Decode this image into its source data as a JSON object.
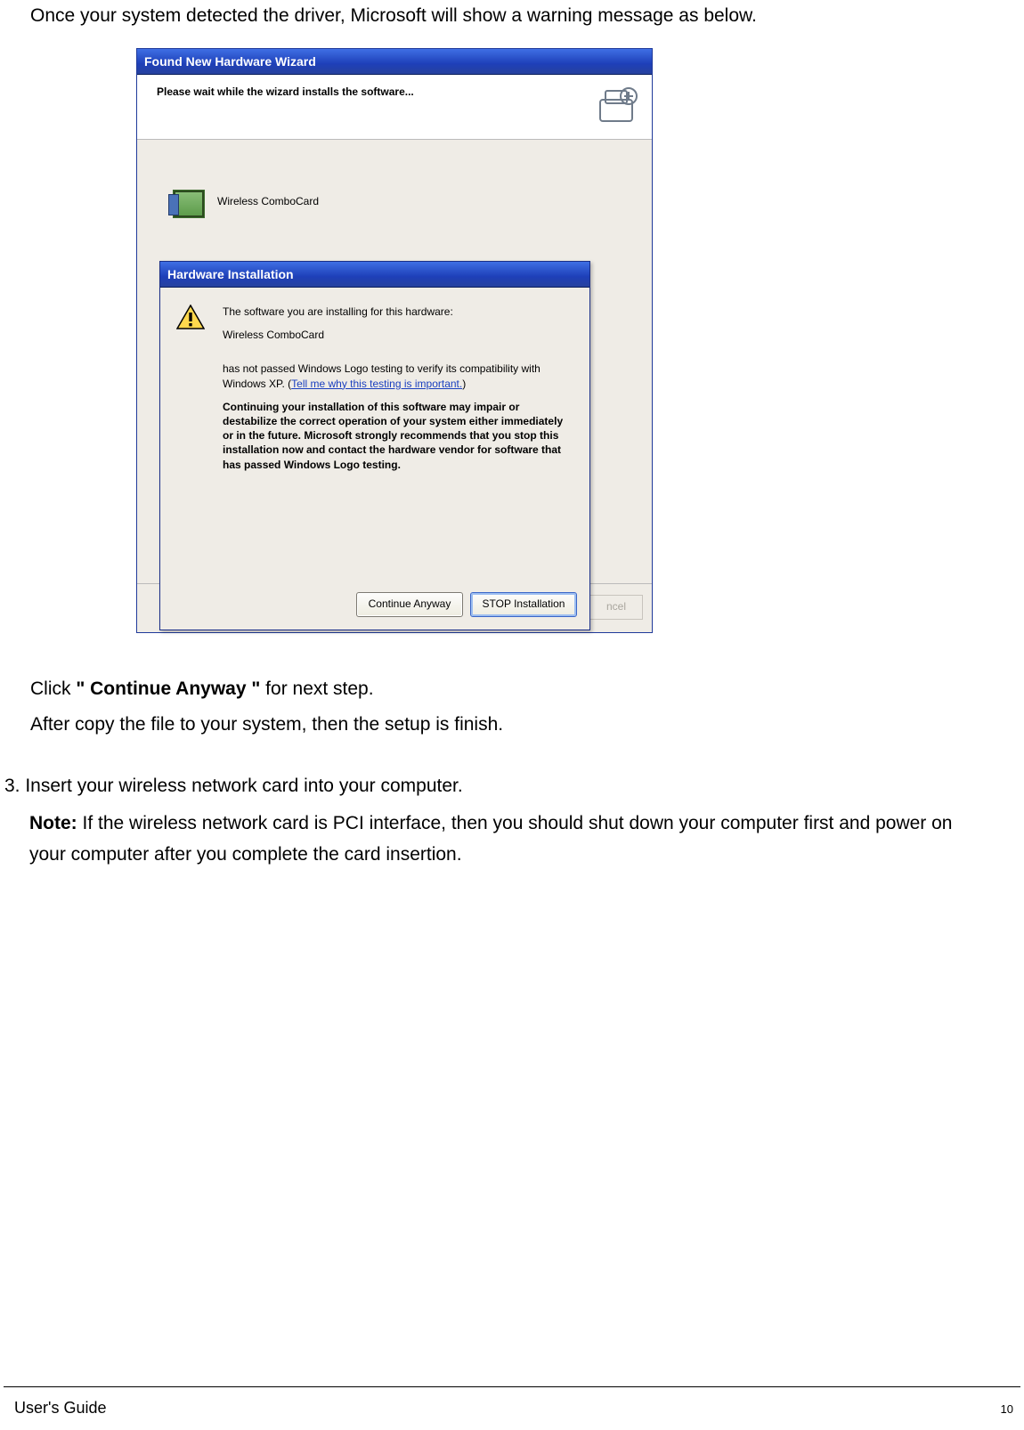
{
  "intro": "Once your system detected the driver, Microsoft will show a warning message as below.",
  "wizard": {
    "title": "Found New Hardware Wizard",
    "header": "Please wait while the wizard installs the software...",
    "device_name": "Wireless ComboCard",
    "cancel_label": "ncel"
  },
  "hw_dialog": {
    "title": "Hardware Installation",
    "line_intro": "The software you are installing for this hardware:",
    "device_name": "Wireless ComboCard",
    "logo_line": "has not passed Windows Logo testing to verify its compatibility with Windows XP. (",
    "logo_link": "Tell me why this testing is important.",
    "logo_line_close": ")",
    "warning_bold": "Continuing your installation of this software may impair or destabilize the correct operation of your system either immediately or in the future. Microsoft strongly recommends that you stop this installation now and contact the hardware vendor for software that has passed Windows Logo testing.",
    "continue_label": "Continue Anyway",
    "stop_label": "STOP Installation"
  },
  "click_line": {
    "pre": "Click ",
    "bold": "\" Continue Anyway \"",
    "post": " for next step."
  },
  "after_copy": "After copy the file to your system, then the setup is finish.",
  "step3": {
    "line1": "3. Insert your wireless network card into your computer.",
    "note_label": "Note:",
    "note_body": " If the wireless network card is PCI interface, then you should shut down your computer first and power on your computer after you complete the card insertion."
  },
  "footer": {
    "guide": "User's Guide",
    "page": "10"
  }
}
